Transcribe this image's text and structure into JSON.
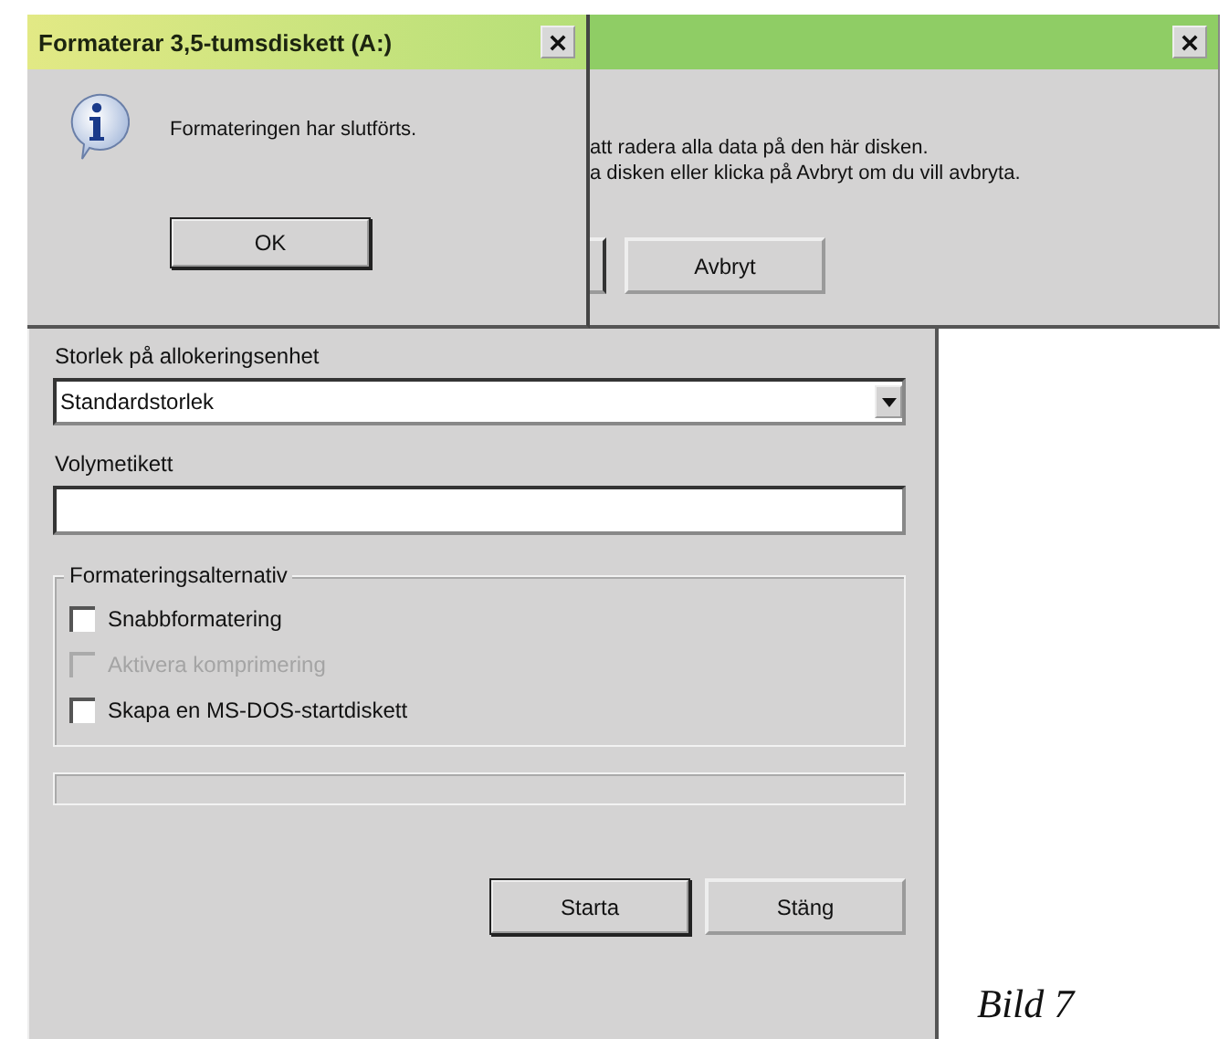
{
  "format_dialog": {
    "allocation_label": "Storlek på allokeringsenhet",
    "allocation_value": "Standardstorlek",
    "volume_label": "Volymetikett",
    "options_group": "Formateringsalternativ",
    "options": [
      {
        "label": "Snabbformatering",
        "checked": false,
        "disabled": false
      },
      {
        "label": "Aktivera komprimering",
        "checked": false,
        "disabled": true
      },
      {
        "label": "Skapa en MS-DOS-startdiskett",
        "checked": false,
        "disabled": false
      }
    ],
    "progress": {
      "level": 0
    },
    "buttons": [
      {
        "label": "Starta",
        "default": true
      },
      {
        "label": "Stäng",
        "default": false
      }
    ]
  },
  "warning_dialog": {
    "lines": [
      "att radera alla data på den här disken.",
      "a disken eller klicka på Avbryt om du vill avbryta."
    ],
    "buttons": [
      {
        "label": "Avbryt",
        "default": false
      }
    ]
  },
  "message_dialog": {
    "title": "Formaterar 3,5-tumsdiskett (A:)",
    "message": "Formateringen har slutförts.",
    "buttons": [
      {
        "label": "OK",
        "default": true
      }
    ]
  },
  "caption": "Bild 7"
}
